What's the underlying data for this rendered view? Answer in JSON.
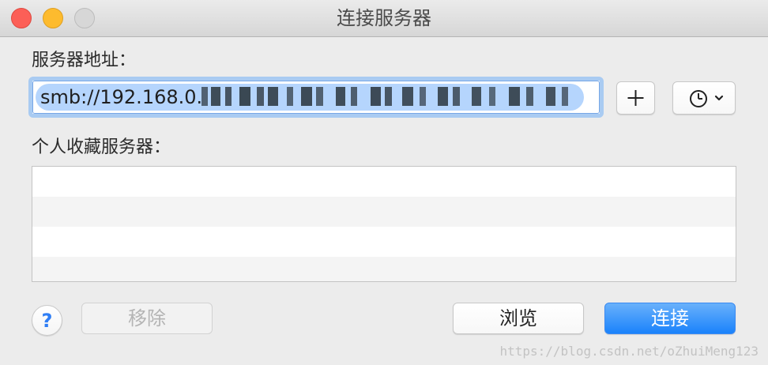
{
  "window": {
    "title": "连接服务器"
  },
  "address": {
    "label": "服务器地址：",
    "value_visible": "smb://192.168.0."
  },
  "favorites": {
    "label": "个人收藏服务器："
  },
  "buttons": {
    "help": "?",
    "remove": "移除",
    "browse": "浏览",
    "connect": "连接"
  },
  "icons": {
    "plus": "plus-icon",
    "history": "clock-icon",
    "chevron": "chevron-down-icon"
  },
  "watermark": "https://blog.csdn.net/oZhuiMeng123",
  "colors": {
    "close": "#fc5f57",
    "minimize": "#fdbb2e",
    "zoom": "#d7d7d7",
    "focus_ring": "#a9cbf2",
    "selection": "#b5d5fd",
    "primary": "#1a82fb",
    "help_icon": "#2f7ef5"
  }
}
